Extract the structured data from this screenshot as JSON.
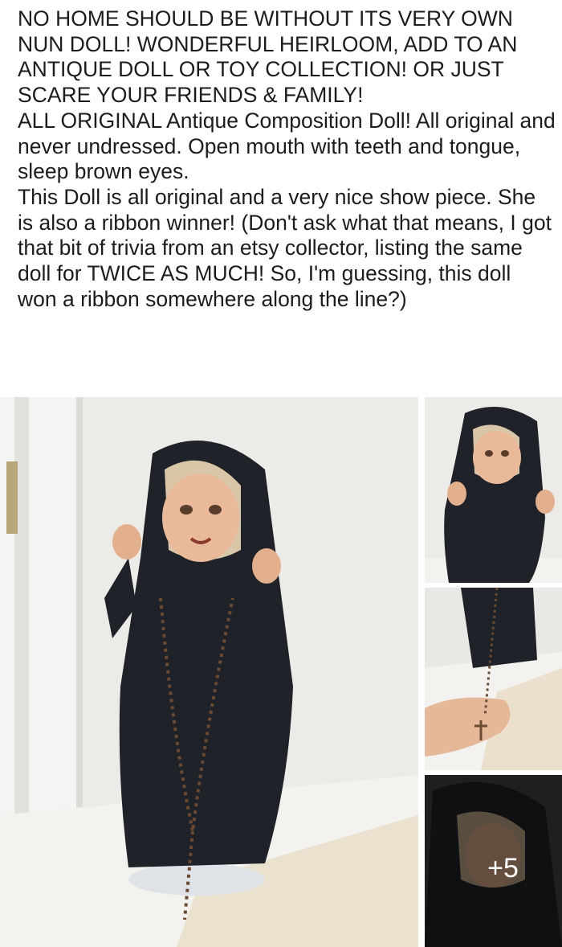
{
  "post": {
    "paragraphs": [
      "NO HOME SHOULD BE WITHOUT ITS VERY OWN NUN DOLL! WONDERFUL HEIRLOOM, ADD TO AN ANTIQUE DOLL OR TOY COLLECTION! OR JUST SCARE YOUR FRIENDS & FAMILY!",
      "ALL ORIGINAL Antique Composition Doll! All original and never undressed. Open mouth with teeth and tongue, sleep brown eyes.",
      "This Doll is all original and a very nice show piece. She is also a ribbon winner! (Don't ask what that means, I got that bit of trivia from an etsy collector, listing the same doll for TWICE AS MUCH! So, I'm guessing, this doll won a ribbon somewhere along the line?)"
    ]
  },
  "gallery": {
    "more_count_label": "+5"
  },
  "colors": {
    "text": "#1c1c1c",
    "habit": "#1f2329",
    "wall": "#ecebe8",
    "overlay": "rgba(0,0,0,0.45)"
  }
}
